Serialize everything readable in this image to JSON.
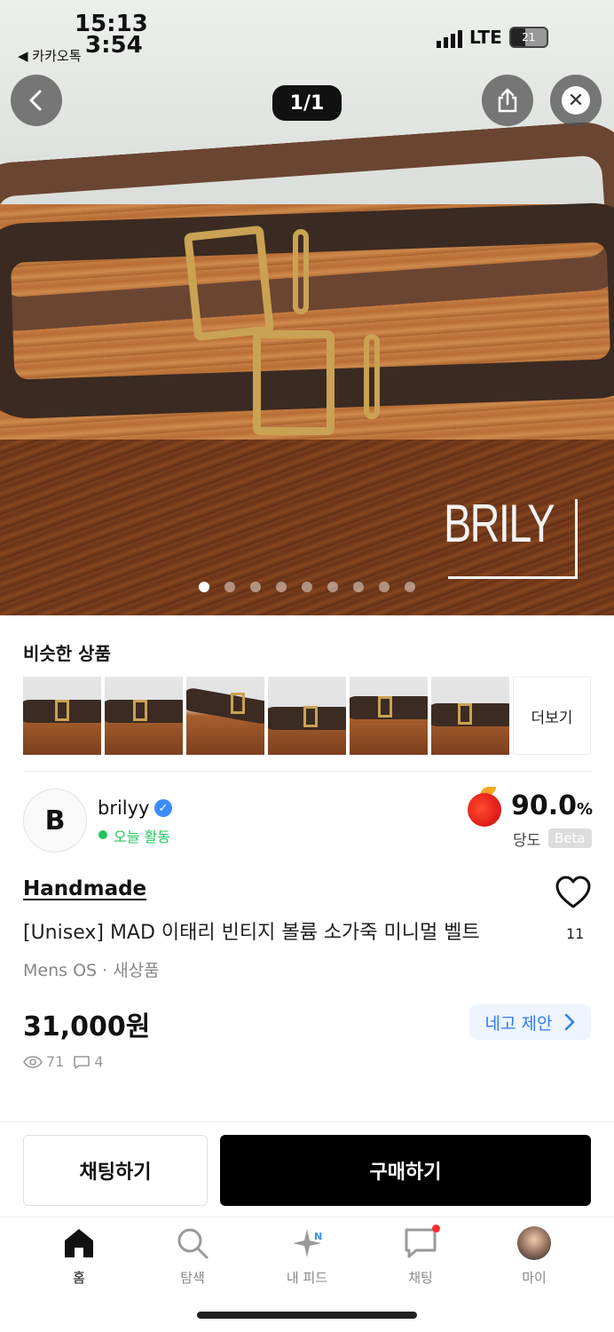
{
  "status_bar": {
    "time_top": "15:13",
    "time_bottom": "3:54",
    "back_app": "◀ 카카오톡",
    "network": "LTE",
    "battery": "21"
  },
  "top_bar": {
    "page_counter": "1/1"
  },
  "hero": {
    "watermark": "BRILY",
    "dot_count": 9,
    "active_dot": 0
  },
  "similar": {
    "title": "비슷한 상품",
    "more_label": "더보기",
    "thumbs": [
      "similar-belt-1",
      "similar-belt-2",
      "similar-belt-3",
      "similar-belt-4",
      "similar-belt-5",
      "similar-belt-6"
    ]
  },
  "seller": {
    "avatar_letter": "B",
    "name": "brilyy",
    "activity": "오늘 활동",
    "sweetness_value": "90.0",
    "sweetness_unit": "%",
    "sweetness_label": "당도",
    "beta": "Beta"
  },
  "product": {
    "tag": "Handmade",
    "title": "[Unisex] MAD 이태리 빈티지 볼륨 소가죽 미니멀 벨트",
    "meta": "Mens OS · 새상품",
    "price": "31,000원",
    "like_count": "11",
    "offer_label": "네고 제안",
    "views": "71",
    "chats": "4"
  },
  "actions": {
    "chat_label": "채팅하기",
    "buy_label": "구매하기"
  },
  "nav": {
    "items": [
      {
        "label": "홈",
        "icon": "home-icon"
      },
      {
        "label": "탐색",
        "icon": "search-icon"
      },
      {
        "label": "내 피드",
        "icon": "sparkle-icon"
      },
      {
        "label": "채팅",
        "icon": "chat-bubble-icon"
      },
      {
        "label": "마이",
        "icon": "profile-icon"
      }
    ],
    "feed_badge": "N"
  },
  "colors": {
    "accent_blue": "#2f7bf5",
    "active_green": "#22c55e",
    "buy_black": "#000000",
    "badge_red": "#ff2d2d"
  }
}
